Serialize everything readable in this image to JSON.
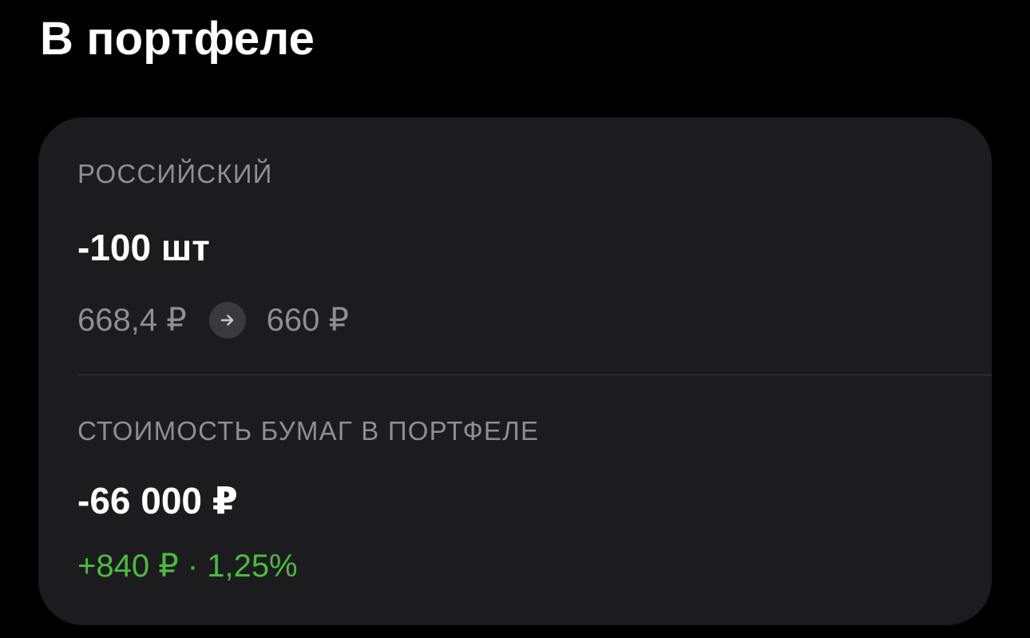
{
  "header": {
    "title": "В портфеле"
  },
  "card": {
    "market_label": "РОССИЙСКИЙ",
    "quantity": "-100 шт",
    "price_from": "668,4 ₽",
    "price_to": "660 ₽",
    "arrow_icon": "arrow-right-icon",
    "value_label": "СТОИМОСТЬ БУМАГ В ПОРТФЕЛЕ",
    "value_amount": "-66 000 ₽",
    "change": "+840 ₽ · 1,25%"
  },
  "colors": {
    "background": "#000000",
    "card": "#1c1c1e",
    "primary_text": "#ffffff",
    "secondary_text": "#8e8e93",
    "positive": "#4cbb3f"
  }
}
